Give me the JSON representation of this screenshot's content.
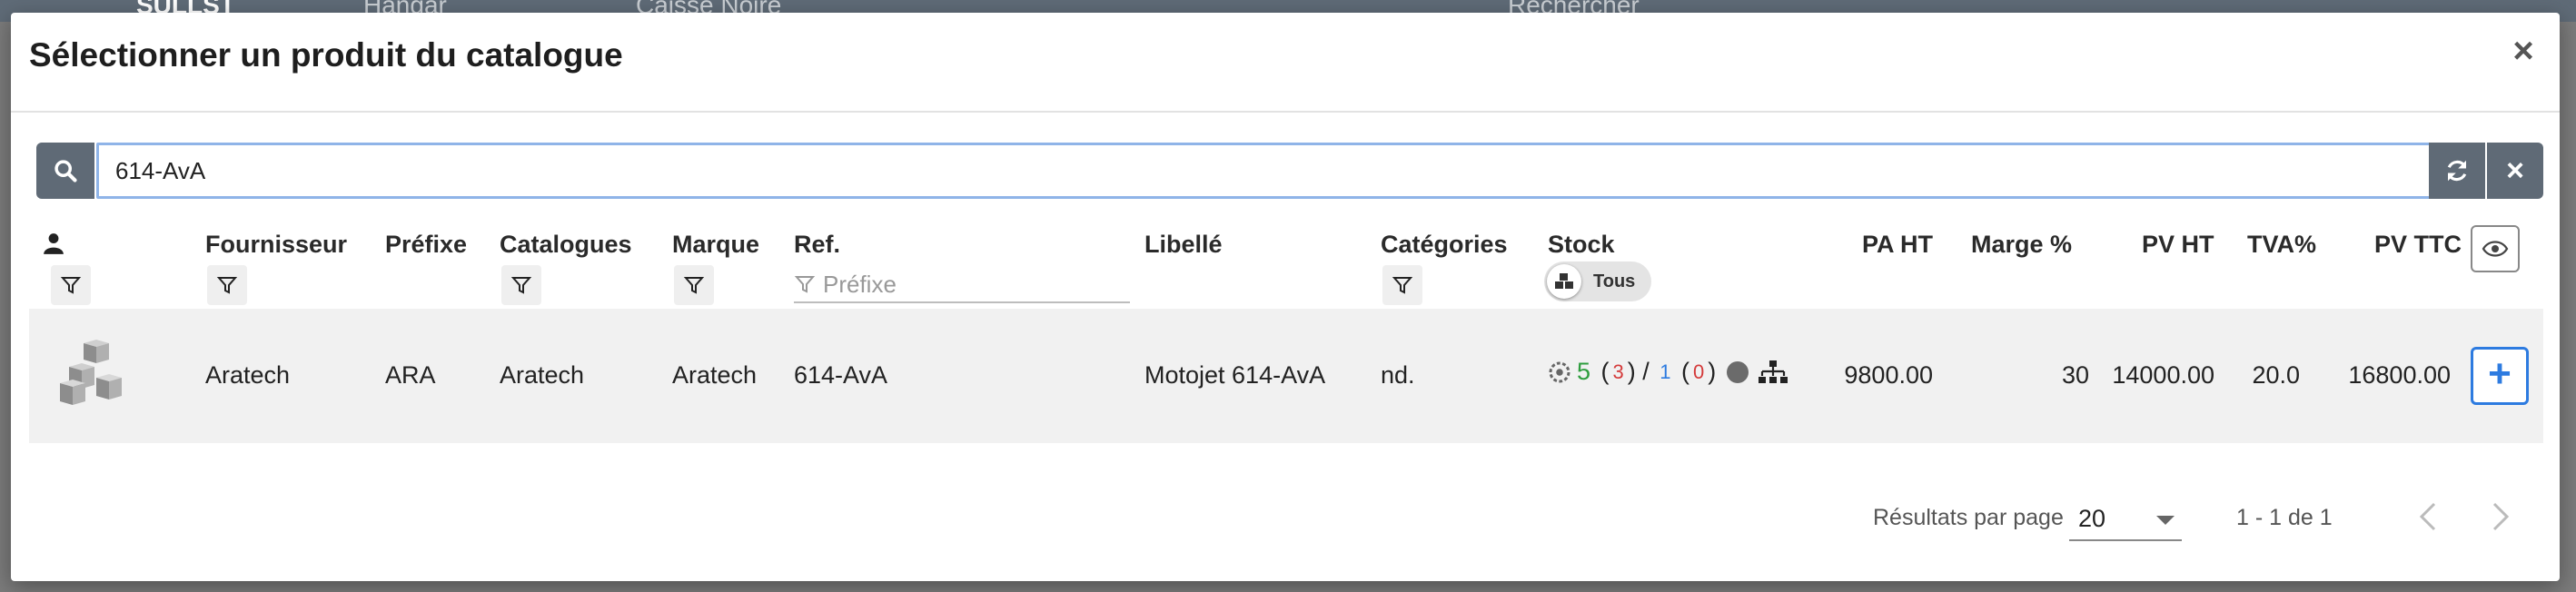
{
  "background": {
    "brand": "SULLST",
    "menu1": "Hangar",
    "menu2": "Caisse Noire",
    "search_placeholder": "Rechercher"
  },
  "dialog": {
    "title": "Sélectionner un produit du catalogue",
    "close": "×"
  },
  "search": {
    "value": "614-AvA",
    "clear": "×"
  },
  "columns": {
    "fournisseur": "Fournisseur",
    "prefixe": "Préfixe",
    "catalogues": "Catalogues",
    "marque": "Marque",
    "ref": "Ref.",
    "ref_placeholder": "Préfixe",
    "libelle": "Libellé",
    "categories": "Catégories",
    "stock": "Stock",
    "stock_toggle": "Tous",
    "pa_ht": "PA HT",
    "marge": "Marge %",
    "pv_ht": "PV HT",
    "tva": "TVA%",
    "pv_ttc": "PV TTC"
  },
  "rows": [
    {
      "fournisseur": "Aratech",
      "prefixe": "ARA",
      "catalogues": "Aratech",
      "marque": "Aratech",
      "ref": "614-AvA",
      "libelle": "Motojet 614-AvA",
      "categories": "nd.",
      "stock_available": "5",
      "stock_reserved": "3",
      "stock_ordered": "1",
      "stock_pending": "0",
      "pa_ht": "9800.00",
      "marge": "30",
      "pv_ht": "14000.00",
      "tva": "20.0",
      "pv_ttc": "16800.00",
      "add": "+"
    }
  ],
  "pagination": {
    "per_page_label": "Résultats par page",
    "per_page": "20",
    "range": "1 - 1 de 1"
  },
  "colors": {
    "accent": "#2d7be0",
    "toolbar": "#5f6a76",
    "green": "#2e9d3e",
    "red": "#d43a3a"
  }
}
